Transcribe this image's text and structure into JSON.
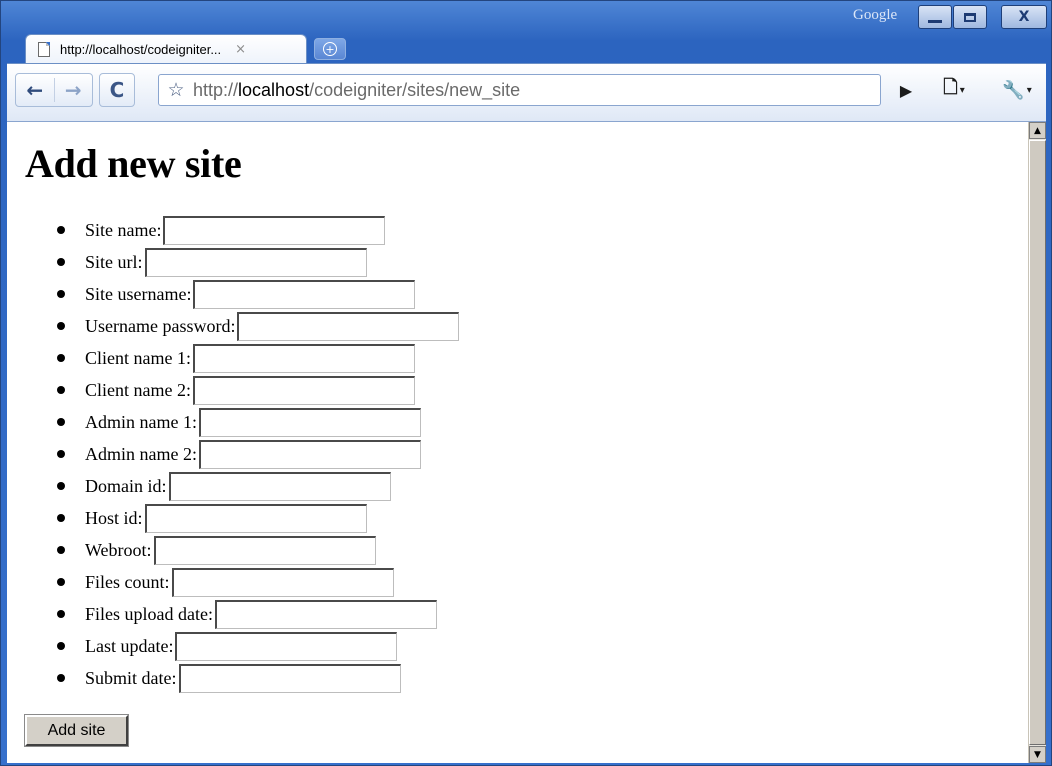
{
  "window": {
    "brand": "Google",
    "controls": {
      "minimize": "—",
      "maximize": "□",
      "close": "X"
    }
  },
  "tab": {
    "title": "http://localhost/codeigniter...",
    "close": "×",
    "new_tab": "+"
  },
  "toolbar": {
    "back": "←",
    "forward": "→",
    "reload": "C",
    "star": "☆",
    "url_prefix": "http://",
    "url_host": "localhost",
    "url_path": "/codeigniter/sites/new_site",
    "go": "▶",
    "page_menu": "🗋",
    "wrench_menu": "🔧",
    "caret": "▾"
  },
  "page": {
    "heading": "Add new site",
    "fields": [
      {
        "label": "Site name:",
        "value": ""
      },
      {
        "label": "Site url:",
        "value": ""
      },
      {
        "label": "Site username:",
        "value": ""
      },
      {
        "label": "Username password:",
        "value": ""
      },
      {
        "label": "Client name 1:",
        "value": ""
      },
      {
        "label": "Client name 2:",
        "value": ""
      },
      {
        "label": "Admin name 1:",
        "value": ""
      },
      {
        "label": "Admin name 2:",
        "value": ""
      },
      {
        "label": "Domain id:",
        "value": ""
      },
      {
        "label": "Host id:",
        "value": ""
      },
      {
        "label": "Webroot:",
        "value": ""
      },
      {
        "label": "Files count:",
        "value": ""
      },
      {
        "label": "Files upload date:",
        "value": ""
      },
      {
        "label": "Last update:",
        "value": ""
      },
      {
        "label": "Submit date:",
        "value": ""
      }
    ],
    "submit_label": "Add site"
  },
  "scrollbar": {
    "up": "▲",
    "down": "▼"
  }
}
